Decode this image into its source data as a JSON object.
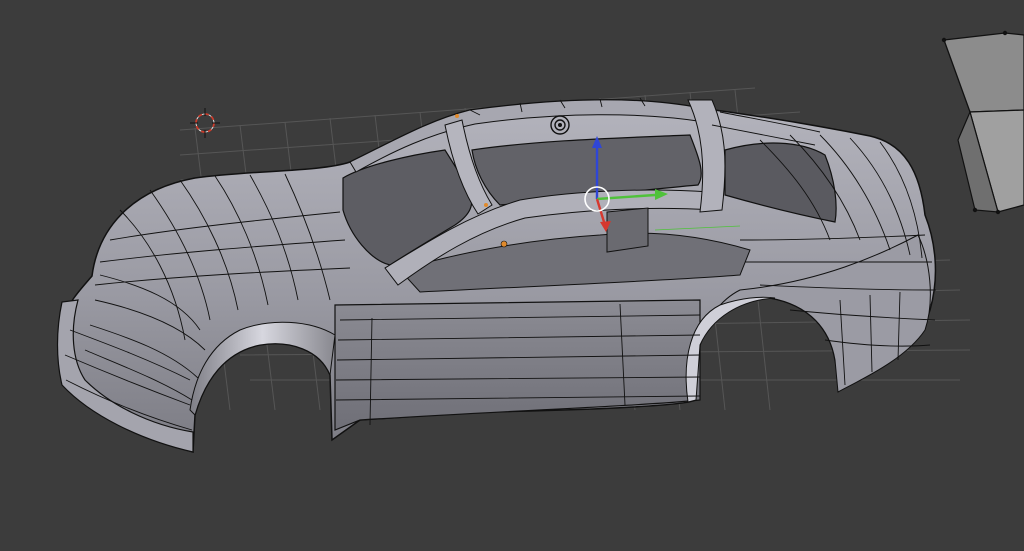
{
  "viewport": {
    "background": "#3c3c3c",
    "grid_color": "#5a5a5a",
    "mesh_fill": "#8e8e96",
    "mesh_fill_light": "#b6b6bf",
    "mesh_fill_dark": "#5f5f66",
    "wire_color": "#111111",
    "axis_x_color": "#d6382f",
    "axis_y_color": "#4fc23a",
    "axis_z_color": "#2f46d6",
    "cursor_color": "#cc3b2b",
    "origin_color": "#e08a2c"
  },
  "objects": {
    "main_mesh": "car-body",
    "secondary_mesh": "ramp-object"
  },
  "gizmos": {
    "transform": "translate-manipulator",
    "camera": "camera-icon",
    "cursor": "3d-cursor"
  }
}
